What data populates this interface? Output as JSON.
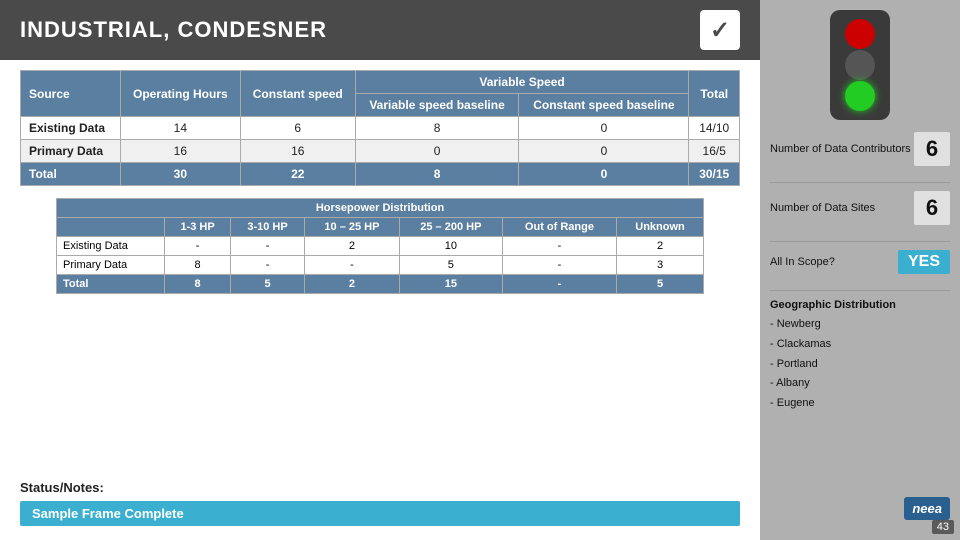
{
  "header": {
    "title": "INDUSTRIAL, CONDESNER",
    "checkmark": "✓"
  },
  "mainTable": {
    "headers": {
      "source": "Source",
      "operatingHours": "Operating Hours",
      "constantSpeed": "Constant speed",
      "variableSpeed": "Variable Speed",
      "variableSpeedBaseline": "Variable speed baseline",
      "constantSpeedBaseline": "Constant speed baseline",
      "total": "Total"
    },
    "rows": [
      {
        "source": "Existing Data",
        "operatingHours": "14",
        "constantSpeed": "6",
        "variableSpeedBaseline": "8",
        "constantSpeedBaseline": "0",
        "total": "14/10"
      },
      {
        "source": "Primary Data",
        "operatingHours": "16",
        "constantSpeed": "16",
        "variableSpeedBaseline": "0",
        "constantSpeedBaseline": "0",
        "total": "16/5"
      },
      {
        "source": "Total",
        "operatingHours": "30",
        "constantSpeed": "22",
        "variableSpeedBaseline": "8",
        "constantSpeedBaseline": "0",
        "total": "30/15"
      }
    ]
  },
  "hpTable": {
    "title": "Horsepower Distribution",
    "headers": [
      "1-3 HP",
      "3-10 HP",
      "10 – 25 HP",
      "25 – 200 HP",
      "Out of Range",
      "Unknown"
    ],
    "rows": [
      {
        "label": "Existing Data",
        "values": [
          "-",
          "-",
          "2",
          "10",
          "-",
          "2"
        ]
      },
      {
        "label": "Primary Data",
        "values": [
          "8",
          "-",
          "-",
          "5",
          "-",
          "3"
        ]
      },
      {
        "label": "Total",
        "values": [
          "8",
          "5",
          "2",
          "15",
          "-",
          "5"
        ]
      }
    ]
  },
  "statusNotes": {
    "heading": "Status/Notes:",
    "sampleFrame": "Sample Frame Complete"
  },
  "rightPanel": {
    "numContributors": {
      "label": "Number of Data Contributors",
      "value": "6"
    },
    "numSites": {
      "label": "Number of Data Sites",
      "value": "6"
    },
    "allInScope": {
      "label": "All In Scope?",
      "value": "YES"
    },
    "geoDistribution": {
      "label": "Geographic Distribution",
      "locations": [
        "Newberg",
        "Clackamas",
        "Portland",
        "Albany",
        "Eugene"
      ]
    },
    "pageNumber": "43",
    "neea": "neea"
  }
}
